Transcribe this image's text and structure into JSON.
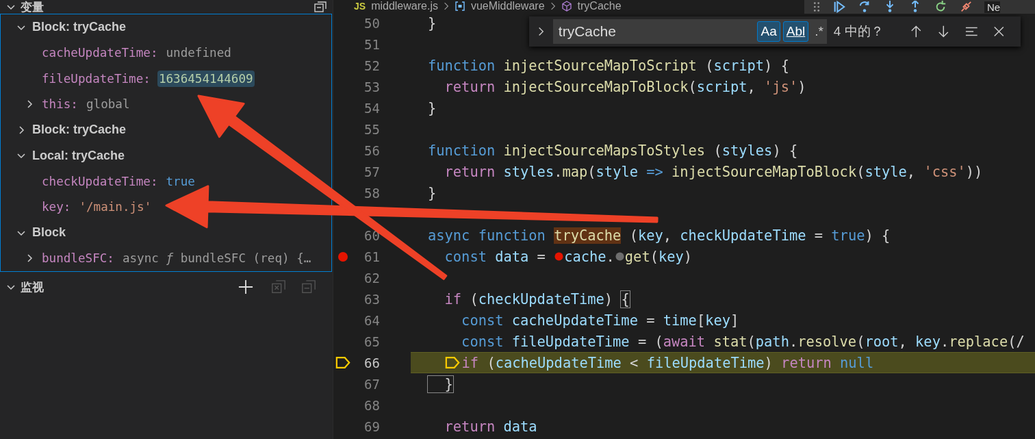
{
  "variables_panel": {
    "title": "变量",
    "expanded": true,
    "scopes": [
      {
        "label": "Block: tryCache",
        "expanded": true,
        "variables": [
          {
            "name": "cacheUpdateTime:",
            "value": "undefined",
            "kind": "undefined",
            "highlighted": false
          },
          {
            "name": "fileUpdateTime:",
            "value": "1636454144609",
            "kind": "number",
            "highlighted": true
          },
          {
            "name": "this:",
            "value": "global",
            "kind": "object",
            "highlighted": false,
            "expanded": false
          }
        ]
      },
      {
        "label": "Block: tryCache",
        "expanded": false
      },
      {
        "label": "Local: tryCache",
        "expanded": true,
        "variables": [
          {
            "name": "checkUpdateTime:",
            "value": "true",
            "kind": "boolean",
            "highlighted": false
          },
          {
            "name": "key:",
            "value": "'/main.js'",
            "kind": "string",
            "highlighted": false
          }
        ]
      },
      {
        "label": "Block",
        "expanded": true,
        "variables": [
          {
            "name": "bundleSFC:",
            "value": "async *ƒ* bundleSFC (req) {…",
            "kind": "function",
            "highlighted": false,
            "expanded": false
          }
        ]
      }
    ]
  },
  "watch_panel": {
    "title": "监视",
    "expanded": true
  },
  "breadcrumb": {
    "badge": "JS",
    "items": [
      {
        "label": "middleware.js",
        "kind": "file"
      },
      {
        "label": "vueMiddleware",
        "kind": "module"
      },
      {
        "label": "tryCache",
        "kind": "method"
      }
    ]
  },
  "debug_toolbar": {
    "overflow_text": "Ne"
  },
  "find_widget": {
    "expanded": false,
    "query": "tryCache",
    "options": [
      {
        "label": "Aa",
        "kind": "case",
        "selected": true
      },
      {
        "label": "Abl",
        "kind": "word",
        "selected": true
      },
      {
        "label": ".*",
        "kind": "regex",
        "selected": false
      }
    ],
    "count": "4 中的？"
  },
  "editor": {
    "lines": [
      {
        "number": "50",
        "breakpoint": false,
        "current": false,
        "tokens": [
          {
            "text": "}",
            "kind": "plain"
          }
        ]
      },
      {
        "number": "51",
        "breakpoint": false,
        "current": false
      },
      {
        "number": "52",
        "breakpoint": false,
        "current": false,
        "tokens": [
          {
            "text": "function ",
            "kind": "keyword"
          },
          {
            "text": "injectSourceMapToScript",
            "kind": "function"
          },
          {
            "text": " (",
            "kind": "plain"
          },
          {
            "text": "script",
            "kind": "variable"
          },
          {
            "text": ") {",
            "kind": "plain"
          }
        ]
      },
      {
        "number": "53",
        "breakpoint": false,
        "current": false,
        "tokens": [
          {
            "text": "  return ",
            "kind": "control"
          },
          {
            "text": "injectSourceMapToBlock",
            "kind": "function"
          },
          {
            "text": "(",
            "kind": "plain"
          },
          {
            "text": "script",
            "kind": "variable"
          },
          {
            "text": ", ",
            "kind": "plain"
          },
          {
            "text": "'js'",
            "kind": "string"
          },
          {
            "text": ")",
            "kind": "plain"
          }
        ]
      },
      {
        "number": "54",
        "breakpoint": false,
        "current": false,
        "tokens": [
          {
            "text": "}",
            "kind": "plain"
          }
        ]
      },
      {
        "number": "55",
        "breakpoint": false,
        "current": false
      },
      {
        "number": "56",
        "breakpoint": false,
        "current": false,
        "tokens": [
          {
            "text": "function ",
            "kind": "keyword"
          },
          {
            "text": "injectSourceMapsToStyles",
            "kind": "function"
          },
          {
            "text": " (",
            "kind": "plain"
          },
          {
            "text": "styles",
            "kind": "variable"
          },
          {
            "text": ") {",
            "kind": "plain"
          }
        ]
      },
      {
        "number": "57",
        "breakpoint": false,
        "current": false,
        "tokens": [
          {
            "text": "  return ",
            "kind": "control"
          },
          {
            "text": "styles",
            "kind": "variable"
          },
          {
            "text": ".",
            "kind": "plain"
          },
          {
            "text": "map",
            "kind": "function"
          },
          {
            "text": "(",
            "kind": "plain"
          },
          {
            "text": "style ",
            "kind": "variable"
          },
          {
            "text": "=> ",
            "kind": "keyword"
          },
          {
            "text": "injectSourceMapToBlock",
            "kind": "function"
          },
          {
            "text": "(",
            "kind": "plain"
          },
          {
            "text": "style",
            "kind": "variable"
          },
          {
            "text": ", ",
            "kind": "plain"
          },
          {
            "text": "'css'",
            "kind": "string"
          },
          {
            "text": "))",
            "kind": "plain"
          }
        ]
      },
      {
        "number": "58",
        "breakpoint": false,
        "current": false,
        "tokens": [
          {
            "text": "}",
            "kind": "plain"
          }
        ]
      },
      {
        "breakpoint": false,
        "current": false
      },
      {
        "number": "60",
        "breakpoint": false,
        "current": false,
        "tokens": [
          {
            "text": "async function ",
            "kind": "keyword"
          },
          {
            "text": "tryCache",
            "kind": "match"
          },
          {
            "text": " (",
            "kind": "plain"
          },
          {
            "text": "key",
            "kind": "variable"
          },
          {
            "text": ", ",
            "kind": "plain"
          },
          {
            "text": "checkUpdateTime",
            "kind": "variable"
          },
          {
            "text": " = ",
            "kind": "plain"
          },
          {
            "text": "true",
            "kind": "keyword"
          },
          {
            "text": ") {",
            "kind": "plain"
          }
        ]
      },
      {
        "number": "61",
        "breakpoint": true,
        "current": false,
        "tokens": [
          {
            "text": "  const ",
            "kind": "keyword"
          },
          {
            "text": "data",
            "kind": "variable"
          },
          {
            "text": " = ",
            "kind": "plain"
          },
          {
            "kind": "breakpoint",
            "enabled": true
          },
          {
            "text": "cache",
            "kind": "variable"
          },
          {
            "text": ".",
            "kind": "plain"
          },
          {
            "kind": "breakpoint",
            "enabled": false
          },
          {
            "text": "get",
            "kind": "function"
          },
          {
            "text": "(",
            "kind": "plain"
          },
          {
            "text": "key",
            "kind": "variable"
          },
          {
            "text": ")",
            "kind": "plain"
          }
        ]
      },
      {
        "number": "62",
        "breakpoint": false,
        "current": false
      },
      {
        "number": "63",
        "breakpoint": false,
        "current": false,
        "tokens": [
          {
            "text": "  if",
            "kind": "control"
          },
          {
            "text": " (",
            "kind": "plain"
          },
          {
            "text": "checkUpdateTime",
            "kind": "variable"
          },
          {
            "text": ") ",
            "kind": "plain"
          },
          {
            "text": "{",
            "kind": "bracket"
          }
        ]
      },
      {
        "number": "64",
        "breakpoint": false,
        "current": false,
        "tokens": [
          {
            "text": "    const ",
            "kind": "keyword"
          },
          {
            "text": "cacheUpdateTime",
            "kind": "variable"
          },
          {
            "text": " = ",
            "kind": "plain"
          },
          {
            "text": "time",
            "kind": "variable"
          },
          {
            "text": "[",
            "kind": "plain"
          },
          {
            "text": "key",
            "kind": "variable"
          },
          {
            "text": "]",
            "kind": "plain"
          }
        ]
      },
      {
        "number": "65",
        "breakpoint": false,
        "current": false,
        "tokens": [
          {
            "text": "    const ",
            "kind": "keyword"
          },
          {
            "text": "fileUpdateTime",
            "kind": "variable"
          },
          {
            "text": " = (",
            "kind": "plain"
          },
          {
            "text": "await ",
            "kind": "control"
          },
          {
            "text": "stat",
            "kind": "function"
          },
          {
            "text": "(",
            "kind": "plain"
          },
          {
            "text": "path",
            "kind": "variable"
          },
          {
            "text": ".",
            "kind": "plain"
          },
          {
            "text": "resolve",
            "kind": "function"
          },
          {
            "text": "(",
            "kind": "plain"
          },
          {
            "text": "root",
            "kind": "variable"
          },
          {
            "text": ", ",
            "kind": "plain"
          },
          {
            "text": "key",
            "kind": "variable"
          },
          {
            "text": ".",
            "kind": "plain"
          },
          {
            "text": "replace",
            "kind": "function"
          },
          {
            "text": "(/",
            "kind": "plain"
          }
        ]
      },
      {
        "number": "66",
        "breakpoint": false,
        "current": true,
        "tokens": [
          {
            "kind": "stop"
          },
          {
            "text": "if",
            "kind": "control"
          },
          {
            "text": " (",
            "kind": "plain"
          },
          {
            "text": "cacheUpdateTime",
            "kind": "variable"
          },
          {
            "text": " < ",
            "kind": "plain"
          },
          {
            "text": "fileUpdateTime",
            "kind": "variable"
          },
          {
            "text": ") ",
            "kind": "plain"
          },
          {
            "text": "return ",
            "kind": "control"
          },
          {
            "text": "null",
            "kind": "keyword"
          }
        ]
      },
      {
        "number": "67",
        "breakpoint": false,
        "current": false,
        "tokens": [
          {
            "text": "  }",
            "kind": "bracket"
          }
        ]
      },
      {
        "number": "68",
        "breakpoint": false,
        "current": false
      },
      {
        "number": "69",
        "breakpoint": false,
        "current": false,
        "tokens": [
          {
            "text": "  return ",
            "kind": "control"
          },
          {
            "text": "data",
            "kind": "variable"
          }
        ]
      }
    ]
  }
}
